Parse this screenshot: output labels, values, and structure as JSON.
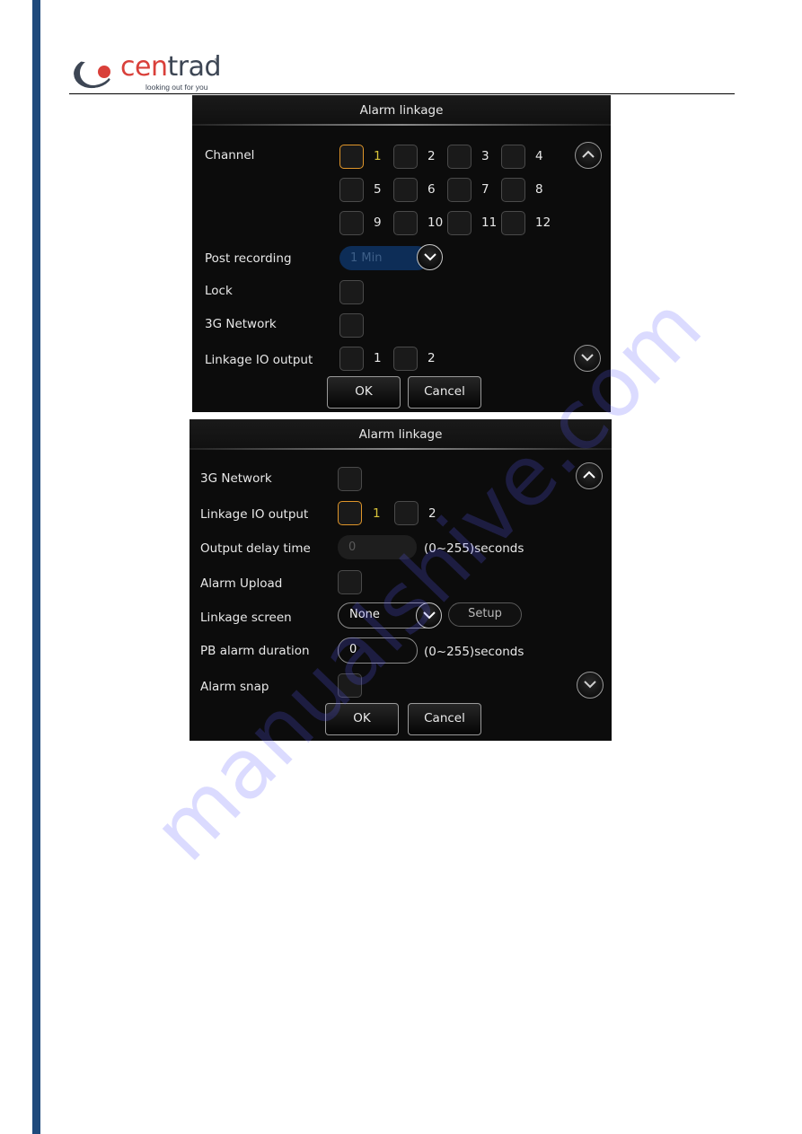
{
  "header": {
    "brand_left": "cen",
    "brand_right": "trad",
    "registered": "®",
    "tagline": "looking out for you"
  },
  "colors": {
    "accent_focus": "#e0962a",
    "focus_number": "#d9c43a",
    "side_bar": "#1f4a7c",
    "brand_red": "#d9403a",
    "panel_bg": "#0c0c0c"
  },
  "panel1": {
    "title": "Alarm linkage",
    "channel_label": "Channel",
    "channels": [
      "1",
      "2",
      "3",
      "4",
      "5",
      "6",
      "7",
      "8",
      "9",
      "10",
      "11",
      "12"
    ],
    "channel_focus": "1",
    "post_recording_label": "Post recording",
    "post_recording_value": "1 Min",
    "lock_label": "Lock",
    "network_label": "3G Network",
    "io_output_label": "Linkage IO output",
    "io_outputs": [
      "1",
      "2"
    ],
    "ok_label": "OK",
    "cancel_label": "Cancel"
  },
  "panel2": {
    "title": "Alarm linkage",
    "network_label": "3G Network",
    "io_output_label": "Linkage IO output",
    "io_outputs": [
      "1",
      "2"
    ],
    "io_focus": "1",
    "output_delay_label": "Output delay time",
    "output_delay_value": "0",
    "output_delay_range": "(0~255)seconds",
    "alarm_upload_label": "Alarm Upload",
    "linkage_screen_label": "Linkage screen",
    "linkage_screen_value": "None",
    "setup_label": "Setup",
    "pb_duration_label": "PB alarm duration",
    "pb_duration_value": "0",
    "pb_duration_range": "(0~255)seconds",
    "alarm_snap_label": "Alarm snap",
    "ok_label": "OK",
    "cancel_label": "Cancel"
  },
  "watermark": "manualshive.com"
}
